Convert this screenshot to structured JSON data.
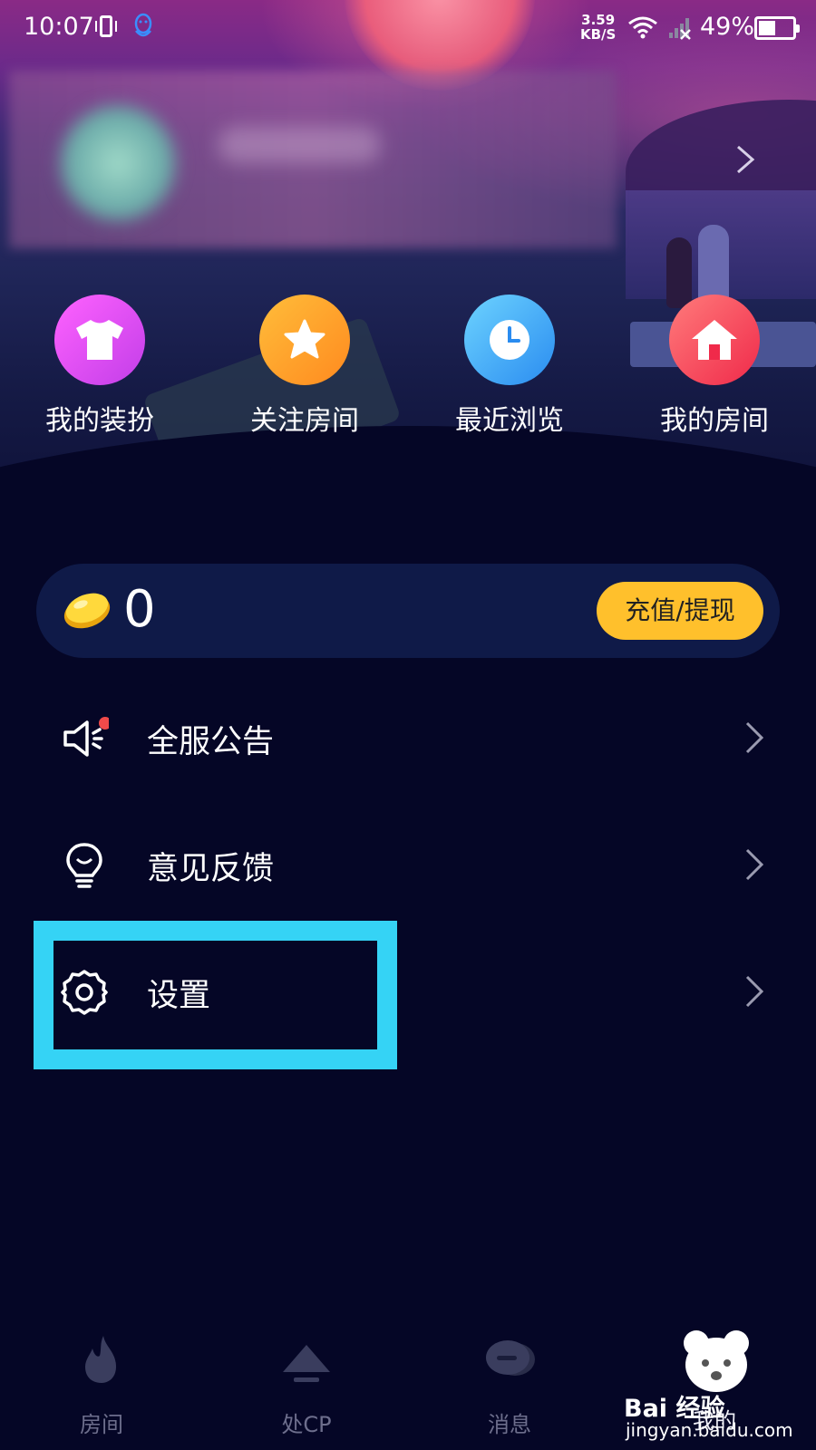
{
  "status_bar": {
    "time": "10:07",
    "net_speed_value": "3.59",
    "net_speed_unit": "KB/S",
    "battery_text": "49%"
  },
  "quick_actions": [
    {
      "label": "我的装扮",
      "icon": "tshirt-icon",
      "color": "#e24cf0"
    },
    {
      "label": "关注房间",
      "icon": "star-icon",
      "color": "#ffa52c"
    },
    {
      "label": "最近浏览",
      "icon": "clock-icon",
      "color": "#3fa6f4"
    },
    {
      "label": "我的房间",
      "icon": "house-icon",
      "color": "#f5475a"
    }
  ],
  "wallet": {
    "balance": "0",
    "recharge_label": "充值/提现",
    "accent": "#ffc02c"
  },
  "menu": [
    {
      "label": "全服公告",
      "icon": "announcement-icon",
      "has_badge": true
    },
    {
      "label": "意见反馈",
      "icon": "lightbulb-icon",
      "has_badge": false
    },
    {
      "label": "设置",
      "icon": "gear-icon",
      "has_badge": false,
      "highlighted": true
    }
  ],
  "highlight_color": "#35d3f5",
  "nav": [
    {
      "label": "房间",
      "icon": "flame-icon"
    },
    {
      "label": "处CP",
      "icon": "mountain-icon"
    },
    {
      "label": "消息",
      "icon": "chat-icon"
    },
    {
      "label": "我的",
      "icon": "profile-icon",
      "active": true
    }
  ],
  "watermark": {
    "text": "Bai 经验",
    "url": "jingyan.baidu.com"
  }
}
